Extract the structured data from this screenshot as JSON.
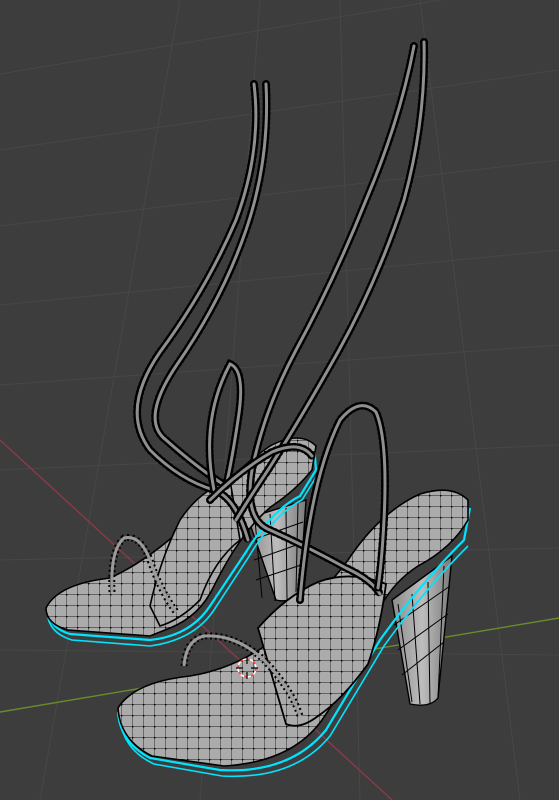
{
  "viewport": {
    "mode": "edit-mode",
    "object": "sandals-mesh",
    "background_color": "#3d3d3d",
    "grid_color": "#474747",
    "x_axis_color": "#8b3a44",
    "y_axis_color": "#6a8b2c",
    "mesh_face_color": "#a8a8a8",
    "wire_color": "#000000",
    "seam_color": "#00e5ff",
    "cursor_color": "#ff4444"
  },
  "icons": {
    "cursor": "3d-cursor-icon"
  }
}
